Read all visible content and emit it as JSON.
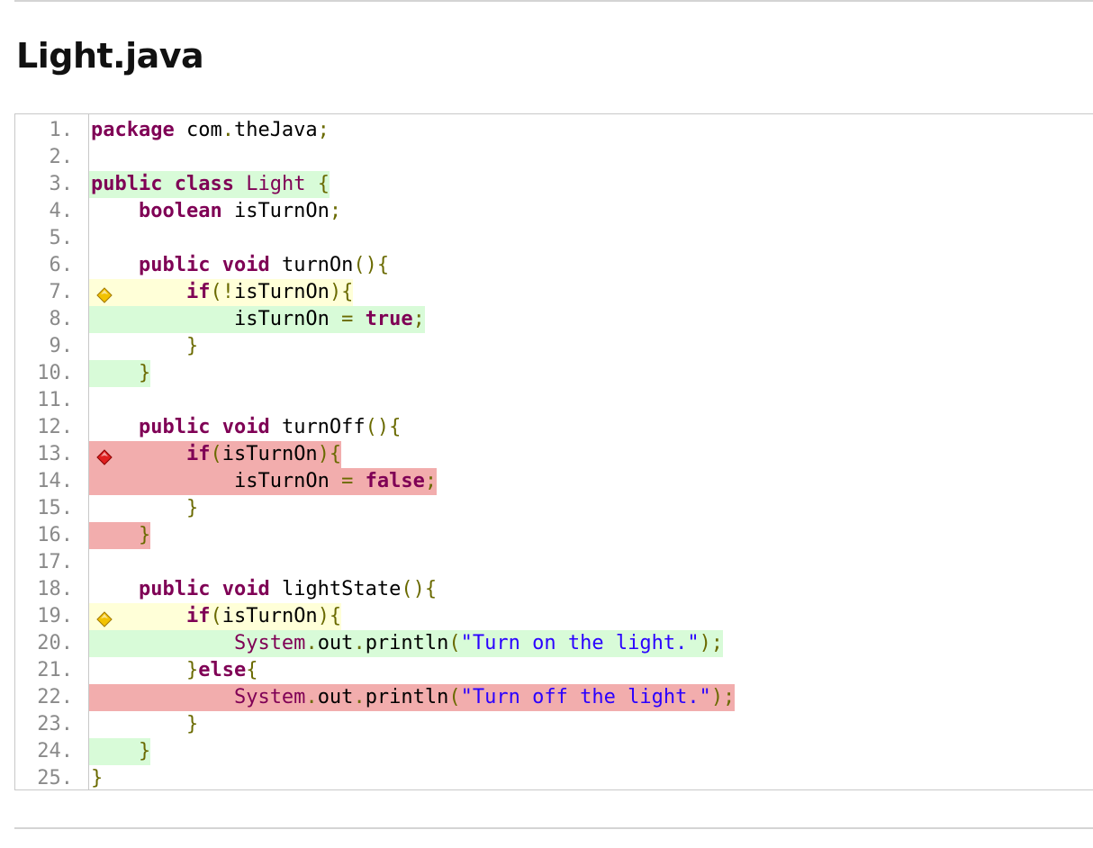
{
  "page": {
    "title": "Light.java"
  },
  "colors": {
    "covered": "#d8fbd8",
    "partial": "#ffffd8",
    "missed": "#f2adad",
    "keyword": "#7f0055",
    "string": "#2a00ff",
    "punctuation": "#6a6a00",
    "line_number": "#8a8a8a"
  },
  "code": {
    "lines": [
      {
        "num": "1.",
        "indent": "",
        "coverage": "none",
        "tokens": [
          {
            "t": "kw",
            "v": "package"
          },
          {
            "t": "pl",
            "v": " com"
          },
          {
            "t": "pu",
            "v": "."
          },
          {
            "t": "pl",
            "v": "theJava"
          },
          {
            "t": "pu",
            "v": ";"
          }
        ]
      },
      {
        "num": "2.",
        "indent": "",
        "coverage": "none",
        "tokens": []
      },
      {
        "num": "3.",
        "indent": "",
        "coverage": "covered",
        "tokens": [
          {
            "t": "kw",
            "v": "public"
          },
          {
            "t": "pl",
            "v": " "
          },
          {
            "t": "kw",
            "v": "class"
          },
          {
            "t": "pl",
            "v": " "
          },
          {
            "t": "cls",
            "v": "Light"
          },
          {
            "t": "pl",
            "v": " "
          },
          {
            "t": "pu",
            "v": "{"
          }
        ]
      },
      {
        "num": "4.",
        "indent": "    ",
        "coverage": "none",
        "tokens": [
          {
            "t": "kw",
            "v": "boolean"
          },
          {
            "t": "pl",
            "v": " isTurnOn"
          },
          {
            "t": "pu",
            "v": ";"
          }
        ]
      },
      {
        "num": "5.",
        "indent": "",
        "coverage": "none",
        "tokens": []
      },
      {
        "num": "6.",
        "indent": "    ",
        "coverage": "none",
        "tokens": [
          {
            "t": "kw",
            "v": "public"
          },
          {
            "t": "pl",
            "v": " "
          },
          {
            "t": "kw",
            "v": "void"
          },
          {
            "t": "pl",
            "v": " turnOn"
          },
          {
            "t": "pu",
            "v": "(){"
          }
        ]
      },
      {
        "num": "7.",
        "indent": "        ",
        "coverage": "partial",
        "marker": "partial-branch-icon",
        "tokens": [
          {
            "t": "kw",
            "v": "if"
          },
          {
            "t": "pu",
            "v": "(!"
          },
          {
            "t": "pl",
            "v": "isTurnOn"
          },
          {
            "t": "pu",
            "v": "){"
          }
        ]
      },
      {
        "num": "8.",
        "indent": "            ",
        "coverage": "covered",
        "tokens": [
          {
            "t": "pl",
            "v": "isTurnOn "
          },
          {
            "t": "pu",
            "v": "="
          },
          {
            "t": "pl",
            "v": " "
          },
          {
            "t": "kw",
            "v": "true"
          },
          {
            "t": "pu",
            "v": ";"
          }
        ]
      },
      {
        "num": "9.",
        "indent": "        ",
        "coverage": "none",
        "tokens": [
          {
            "t": "pu",
            "v": "}"
          }
        ]
      },
      {
        "num": "10.",
        "indent": "    ",
        "coverage": "covered",
        "tokens": [
          {
            "t": "pu",
            "v": "}"
          }
        ]
      },
      {
        "num": "11.",
        "indent": "",
        "coverage": "none",
        "tokens": []
      },
      {
        "num": "12.",
        "indent": "    ",
        "coverage": "none",
        "tokens": [
          {
            "t": "kw",
            "v": "public"
          },
          {
            "t": "pl",
            "v": " "
          },
          {
            "t": "kw",
            "v": "void"
          },
          {
            "t": "pl",
            "v": " turnOff"
          },
          {
            "t": "pu",
            "v": "(){"
          }
        ]
      },
      {
        "num": "13.",
        "indent": "        ",
        "coverage": "missed",
        "marker": "missed-branch-icon",
        "tokens": [
          {
            "t": "kw",
            "v": "if"
          },
          {
            "t": "pu",
            "v": "("
          },
          {
            "t": "pl",
            "v": "isTurnOn"
          },
          {
            "t": "pu",
            "v": "){"
          }
        ]
      },
      {
        "num": "14.",
        "indent": "            ",
        "coverage": "missed",
        "tokens": [
          {
            "t": "pl",
            "v": "isTurnOn "
          },
          {
            "t": "pu",
            "v": "="
          },
          {
            "t": "pl",
            "v": " "
          },
          {
            "t": "kw",
            "v": "false"
          },
          {
            "t": "pu",
            "v": ";"
          }
        ]
      },
      {
        "num": "15.",
        "indent": "        ",
        "coverage": "none",
        "tokens": [
          {
            "t": "pu",
            "v": "}"
          }
        ]
      },
      {
        "num": "16.",
        "indent": "    ",
        "coverage": "missed",
        "tokens": [
          {
            "t": "pu",
            "v": "}"
          }
        ]
      },
      {
        "num": "17.",
        "indent": "",
        "coverage": "none",
        "tokens": []
      },
      {
        "num": "18.",
        "indent": "    ",
        "coverage": "none",
        "tokens": [
          {
            "t": "kw",
            "v": "public"
          },
          {
            "t": "pl",
            "v": " "
          },
          {
            "t": "kw",
            "v": "void"
          },
          {
            "t": "pl",
            "v": " lightState"
          },
          {
            "t": "pu",
            "v": "(){"
          }
        ]
      },
      {
        "num": "19.",
        "indent": "        ",
        "coverage": "partial",
        "marker": "partial-branch-icon",
        "tokens": [
          {
            "t": "kw",
            "v": "if"
          },
          {
            "t": "pu",
            "v": "("
          },
          {
            "t": "pl",
            "v": "isTurnOn"
          },
          {
            "t": "pu",
            "v": "){"
          }
        ]
      },
      {
        "num": "20.",
        "indent": "            ",
        "coverage": "covered",
        "tokens": [
          {
            "t": "cls",
            "v": "System"
          },
          {
            "t": "pu",
            "v": "."
          },
          {
            "t": "pl",
            "v": "out"
          },
          {
            "t": "pu",
            "v": "."
          },
          {
            "t": "pl",
            "v": "println"
          },
          {
            "t": "pu",
            "v": "("
          },
          {
            "t": "str",
            "v": "\"Turn on the light.\""
          },
          {
            "t": "pu",
            "v": ");"
          }
        ]
      },
      {
        "num": "21.",
        "indent": "        ",
        "coverage": "none",
        "tokens": [
          {
            "t": "pu",
            "v": "}"
          },
          {
            "t": "kw",
            "v": "else"
          },
          {
            "t": "pu",
            "v": "{"
          }
        ]
      },
      {
        "num": "22.",
        "indent": "            ",
        "coverage": "missed",
        "tokens": [
          {
            "t": "cls",
            "v": "System"
          },
          {
            "t": "pu",
            "v": "."
          },
          {
            "t": "pl",
            "v": "out"
          },
          {
            "t": "pu",
            "v": "."
          },
          {
            "t": "pl",
            "v": "println"
          },
          {
            "t": "pu",
            "v": "("
          },
          {
            "t": "str",
            "v": "\"Turn off the light.\""
          },
          {
            "t": "pu",
            "v": ");"
          }
        ]
      },
      {
        "num": "23.",
        "indent": "        ",
        "coverage": "none",
        "tokens": [
          {
            "t": "pu",
            "v": "}"
          }
        ]
      },
      {
        "num": "24.",
        "indent": "    ",
        "coverage": "covered",
        "tokens": [
          {
            "t": "pu",
            "v": "}"
          }
        ]
      },
      {
        "num": "25.",
        "indent": "",
        "coverage": "none",
        "tokens": [
          {
            "t": "pu",
            "v": "}"
          }
        ]
      }
    ]
  }
}
